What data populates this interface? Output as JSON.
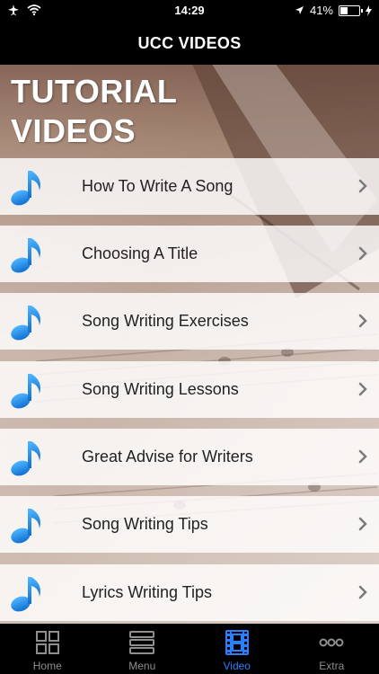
{
  "status": {
    "time": "14:29",
    "battery_percent": "41%",
    "battery_level": 0.41
  },
  "navbar": {
    "title": "UCC VIDEOS"
  },
  "header": {
    "line1": "TUTORIAL",
    "line2": "VIDEOS"
  },
  "list": {
    "items": [
      {
        "label": "How To Write A Song"
      },
      {
        "label": "Choosing A Title"
      },
      {
        "label": "Song Writing Exercises"
      },
      {
        "label": "Song Writing Lessons"
      },
      {
        "label": "Great Advise for Writers"
      },
      {
        "label": "Song Writing Tips"
      },
      {
        "label": "Lyrics Writing Tips"
      }
    ]
  },
  "tabs": [
    {
      "label": "Home",
      "icon": "grid-icon"
    },
    {
      "label": "Menu",
      "icon": "list-icon"
    },
    {
      "label": "Video",
      "icon": "film-icon",
      "active": true
    },
    {
      "label": "Extra",
      "icon": "more-icon"
    }
  ],
  "colors": {
    "accent": "#2a7fff",
    "note": "#1e8fe0",
    "tab_inactive": "#8e8e8e"
  }
}
